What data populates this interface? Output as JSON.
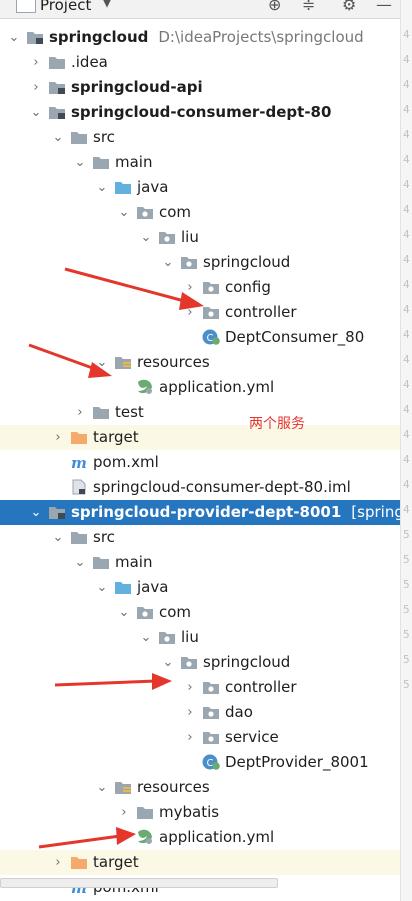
{
  "toolbar": {
    "project_label": "Project",
    "icons": [
      "project-folder-icon",
      "dropdown-icon",
      "locate-icon",
      "collapse-all-icon",
      "settings-gear-icon",
      "hide-icon"
    ]
  },
  "tree": [
    {
      "label": "springcloud",
      "extra": "D:\\ideaProjects\\springcloud",
      "bold": true,
      "icon": "module-folder",
      "indent": 0,
      "chevron": "down"
    },
    {
      "label": ".idea",
      "icon": "folder",
      "indent": 1,
      "chevron": "right"
    },
    {
      "label": "springcloud-api",
      "bold": true,
      "icon": "module-folder",
      "indent": 1,
      "chevron": "right"
    },
    {
      "label": "springcloud-consumer-dept-80",
      "bold": true,
      "icon": "module-folder",
      "indent": 1,
      "chevron": "down"
    },
    {
      "label": "src",
      "icon": "folder",
      "indent": 2,
      "chevron": "down"
    },
    {
      "label": "main",
      "icon": "folder",
      "indent": 3,
      "chevron": "down"
    },
    {
      "label": "java",
      "icon": "source-folder",
      "indent": 4,
      "chevron": "down"
    },
    {
      "label": "com",
      "icon": "package",
      "indent": 5,
      "chevron": "down"
    },
    {
      "label": "liu",
      "icon": "package",
      "indent": 6,
      "chevron": "down"
    },
    {
      "label": "springcloud",
      "icon": "package",
      "indent": 7,
      "chevron": "down"
    },
    {
      "label": "config",
      "icon": "package",
      "indent": 8,
      "chevron": "right"
    },
    {
      "label": "controller",
      "icon": "package",
      "indent": 8,
      "chevron": "right"
    },
    {
      "label": "DeptConsumer_80",
      "icon": "spring-class",
      "indent": 8,
      "chevron": "none"
    },
    {
      "label": "resources",
      "icon": "resources-folder",
      "indent": 4,
      "chevron": "down"
    },
    {
      "label": "application.yml",
      "icon": "spring-yml",
      "indent": 5,
      "chevron": "none"
    },
    {
      "label": "test",
      "icon": "folder",
      "indent": 3,
      "chevron": "right"
    },
    {
      "label": "target",
      "icon": "excluded-folder",
      "indent": 2,
      "chevron": "right",
      "tint": true
    },
    {
      "label": "pom.xml",
      "icon": "maven-file",
      "indent": 2,
      "chevron": "none"
    },
    {
      "label": "springcloud-consumer-dept-80.iml",
      "icon": "iml-file",
      "indent": 2,
      "chevron": "none"
    },
    {
      "label": "springcloud-provider-dept-8001",
      "extra": "[springclou",
      "bold": true,
      "icon": "module-folder",
      "indent": 1,
      "chevron": "down",
      "selected": true
    },
    {
      "label": "src",
      "icon": "folder",
      "indent": 2,
      "chevron": "down"
    },
    {
      "label": "main",
      "icon": "folder",
      "indent": 3,
      "chevron": "down"
    },
    {
      "label": "java",
      "icon": "source-folder",
      "indent": 4,
      "chevron": "down"
    },
    {
      "label": "com",
      "icon": "package",
      "indent": 5,
      "chevron": "down"
    },
    {
      "label": "liu",
      "icon": "package",
      "indent": 6,
      "chevron": "down"
    },
    {
      "label": "springcloud",
      "icon": "package",
      "indent": 7,
      "chevron": "down"
    },
    {
      "label": "controller",
      "icon": "package",
      "indent": 8,
      "chevron": "right"
    },
    {
      "label": "dao",
      "icon": "package",
      "indent": 8,
      "chevron": "right"
    },
    {
      "label": "service",
      "icon": "package",
      "indent": 8,
      "chevron": "right"
    },
    {
      "label": "DeptProvider_8001",
      "icon": "spring-class",
      "indent": 8,
      "chevron": "none"
    },
    {
      "label": "resources",
      "icon": "resources-folder",
      "indent": 4,
      "chevron": "down"
    },
    {
      "label": "mybatis",
      "icon": "folder",
      "indent": 5,
      "chevron": "right"
    },
    {
      "label": "application.yml",
      "icon": "spring-yml",
      "indent": 5,
      "chevron": "none"
    },
    {
      "label": "target",
      "icon": "excluded-folder",
      "indent": 2,
      "chevron": "right",
      "tint": true
    },
    {
      "label": "pom.xml",
      "icon": "maven-file",
      "indent": 2,
      "chevron": "none"
    }
  ],
  "annotation": {
    "text": "两个服务",
    "color": "#e4362b"
  },
  "colors": {
    "selection": "#2675bf",
    "folder": "#9aa7b0",
    "source_folder": "#62b0de",
    "excluded_folder": "#f4aa6b",
    "spring": "#6aab73",
    "maven": "#3d8fd9",
    "annotation_red": "#e4362b"
  },
  "gutter_numbers": [
    "4",
    "4",
    "4",
    "4",
    "4",
    "4",
    "4",
    "4",
    "4",
    "4",
    "4",
    "4",
    "4",
    "4",
    "4",
    "4",
    "4",
    "4",
    "4",
    "4",
    "5",
    "5",
    "5",
    "5",
    "5",
    "5",
    "5"
  ]
}
